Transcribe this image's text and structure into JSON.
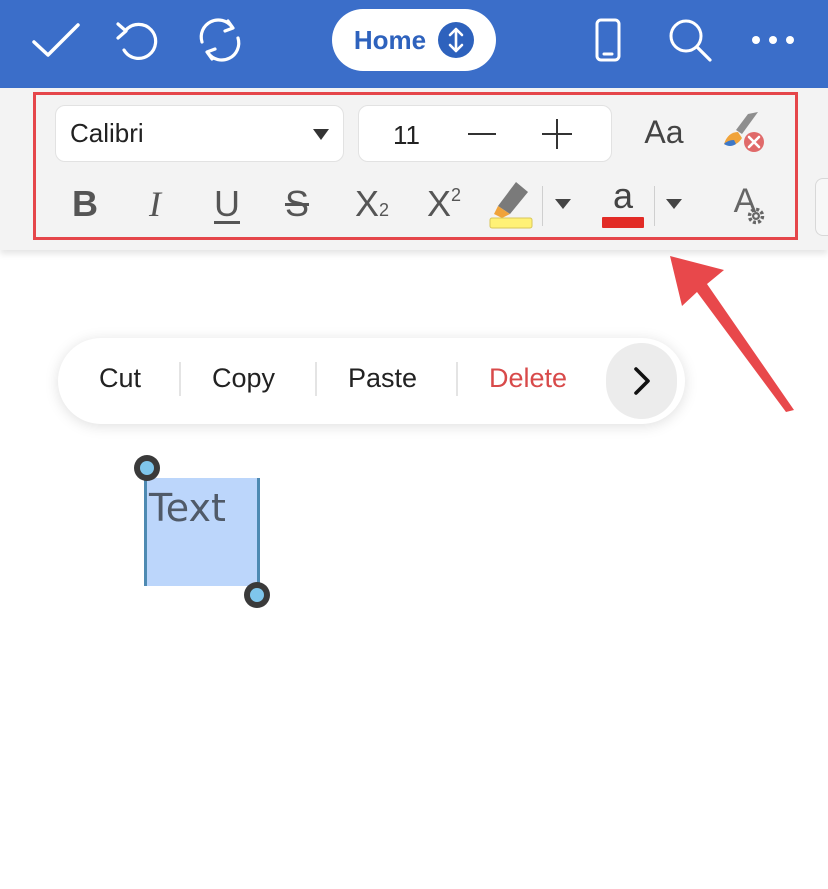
{
  "colors": {
    "app_bar": "#3b6ec9",
    "accent": "#2e62bd",
    "highlight_box": "#e5464a",
    "annotation_arrow": "#e8484b",
    "delete_text": "#d84a4a",
    "highlighter_swatch": "#fff176",
    "font_color_swatch": "#e22b26",
    "selection": "#bcd6fb"
  },
  "top_bar": {
    "home_label": "Home",
    "icons": [
      "check-icon",
      "undo-icon",
      "sync-icon",
      "phone-layout-icon",
      "search-icon",
      "more-icon"
    ]
  },
  "ribbon": {
    "font_name": "Calibri",
    "font_size": "11",
    "change_case_label": "Aa",
    "format_buttons": {
      "bold": "B",
      "italic": "I",
      "underline": "U",
      "strikethrough": "S",
      "subscript_base": "X",
      "subscript_mark": "2",
      "superscript_base": "X",
      "superscript_mark": "2",
      "font_color_glyph": "a",
      "more_format_glyph": "A"
    }
  },
  "context_menu": {
    "items": [
      "Cut",
      "Copy",
      "Paste",
      "Delete"
    ]
  },
  "document": {
    "selected_text": "Text"
  }
}
